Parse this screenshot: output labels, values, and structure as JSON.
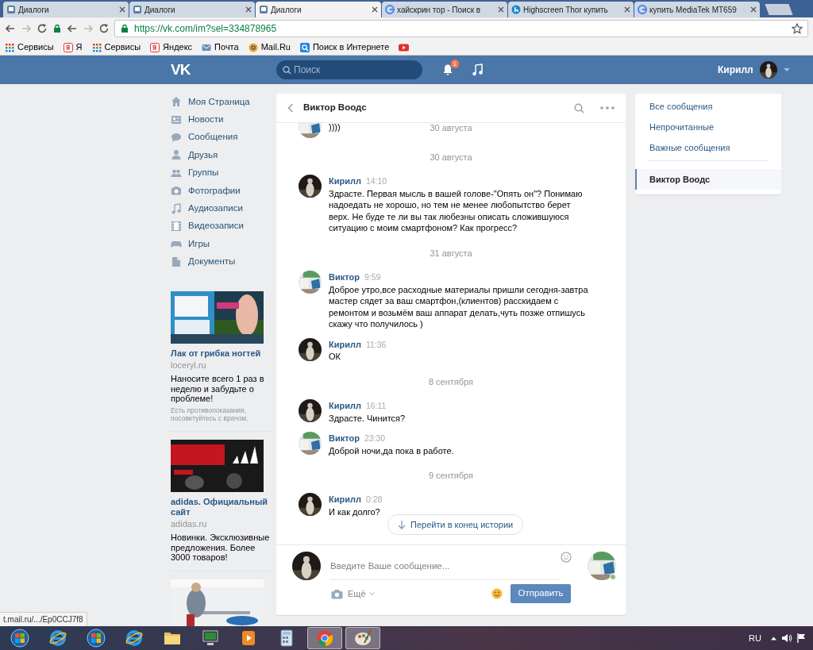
{
  "browser": {
    "tabs": [
      {
        "title": "Диалоги",
        "kind": "vk",
        "selected": false
      },
      {
        "title": "Диалоги",
        "kind": "vk",
        "selected": false
      },
      {
        "title": "Диалоги",
        "kind": "vk",
        "selected": true
      },
      {
        "title": "хайскрин тор - Поиск в",
        "kind": "google",
        "selected": false
      },
      {
        "title": "Highscreen Thor купить",
        "kind": "h",
        "selected": false
      },
      {
        "title": "купить MediaTek MT659",
        "kind": "google",
        "selected": false
      }
    ],
    "url": "https://vk.com/im?sel=334878965",
    "bookmarks": [
      {
        "label": "Сервисы",
        "kind": "apps"
      },
      {
        "label": "Я",
        "kind": "yandex"
      },
      {
        "label": "Сервисы",
        "kind": "apps"
      },
      {
        "label": "Яндекс",
        "kind": "yandex"
      },
      {
        "label": "Почта",
        "kind": "mail"
      },
      {
        "label": "Mail.Ru",
        "kind": "mailru"
      },
      {
        "label": "Поиск в Интернете",
        "kind": "search"
      },
      {
        "kind": "youtube"
      }
    ]
  },
  "header": {
    "logo": "VK",
    "search_placeholder": "Поиск",
    "notifications": "1",
    "user": "Кирилл"
  },
  "menu": [
    {
      "label": "Моя Страница",
      "kind": "home"
    },
    {
      "label": "Новости",
      "kind": "news"
    },
    {
      "label": "Сообщения",
      "kind": "messages"
    },
    {
      "label": "Друзья",
      "kind": "friends"
    },
    {
      "label": "Группы",
      "kind": "groups"
    },
    {
      "label": "Фотографии",
      "kind": "photos"
    },
    {
      "label": "Аудиозаписи",
      "kind": "music"
    },
    {
      "label": "Видеозаписи",
      "kind": "video"
    },
    {
      "label": "Игры",
      "kind": "games"
    },
    {
      "label": "Документы",
      "kind": "docs"
    }
  ],
  "ads": [
    {
      "title": "Лак от грибка ногтей",
      "domain": "loceryl.ru",
      "text": "Наносите всего 1 раз в неделю и забудьте о проблеме!",
      "note": "Есть противопоказания, посоветуйтесь с врачом."
    },
    {
      "title": "adidas. Официальный сайт",
      "domain": "adidas.ru",
      "text": "Новинки. Эксклюзивные предложения. Более 3000 товаров!"
    },
    {
      "kind": "picture"
    }
  ],
  "chat": {
    "title": "Виктор Воодс",
    "sticky_date": "30 августа",
    "items": [
      {
        "kind": "message",
        "avatar": {
          "kind": "viktor"
        },
        "text": "))))"
      },
      {
        "kind": "date",
        "text": "30 августа"
      },
      {
        "kind": "message",
        "avatar": {
          "kind": "kirill"
        },
        "author": "Кирилл",
        "time": "14:10",
        "text": "Здрасте. Первая мысль в вашей голове-\"Опять он\"? Понимаю надоедать не хорошо, но тем не менее любопытство берет верх. Не буде те ли вы так любезны описать сложившуюся ситуацию с моим смартфоном? Как прогресс?"
      },
      {
        "kind": "date",
        "text": "31 августа"
      },
      {
        "kind": "message",
        "avatar": {
          "kind": "viktor"
        },
        "author": "Виктор",
        "time": "9:59",
        "text": "Доброе утро,все расходные материалы пришли сегодня-завтра мастер сядет за ваш смартфон,(клиентов) расскидаем с ремонтом и возьмём ваш аппарат делать,чуть позже отпишусь скажу что получилось )"
      },
      {
        "kind": "message",
        "avatar": {
          "kind": "kirill"
        },
        "author": "Кирилл",
        "time": "11:36",
        "text": "ОК"
      },
      {
        "kind": "date",
        "text": "8 сентября"
      },
      {
        "kind": "message",
        "avatar": {
          "kind": "kirill"
        },
        "author": "Кирилл",
        "time": "16:11",
        "text": "Здрасте. Чинится?"
      },
      {
        "kind": "message",
        "avatar": {
          "kind": "viktor"
        },
        "author": "Виктор",
        "time": "23:30",
        "text": "Доброй ночи,да пока в работе."
      },
      {
        "kind": "date",
        "text": "9 сентября"
      },
      {
        "kind": "message",
        "avatar": {
          "kind": "kirill"
        },
        "author": "Кирилл",
        "time": "0:28",
        "text": "И как долго?"
      }
    ],
    "jump_button": "Перейти в конец истории",
    "composer": {
      "placeholder": "Введите Ваше сообщение...",
      "more": "Ещё",
      "send": "Отправить"
    }
  },
  "filters": [
    {
      "label": "Все сообщения",
      "selected": false
    },
    {
      "label": "Непрочитанные",
      "selected": false
    },
    {
      "label": "Важные сообщения",
      "selected": false
    },
    {
      "label": "Виктор Воодс",
      "selected": true
    }
  ],
  "status_link": "t.mail.ru/.../Ep0CCJ7f8",
  "taskbar": {
    "apps": [
      {
        "kind": "start",
        "active": false
      },
      {
        "kind": "ie",
        "active": false
      },
      {
        "kind": "start",
        "active": false
      },
      {
        "kind": "ie",
        "active": false
      },
      {
        "kind": "folder",
        "active": false
      },
      {
        "kind": "monitor",
        "active": false
      },
      {
        "kind": "media",
        "active": false
      },
      {
        "kind": "calculator",
        "active": false
      },
      {
        "kind": "chrome",
        "active": true
      },
      {
        "kind": "paint",
        "active": true
      }
    ],
    "language": "RU"
  }
}
